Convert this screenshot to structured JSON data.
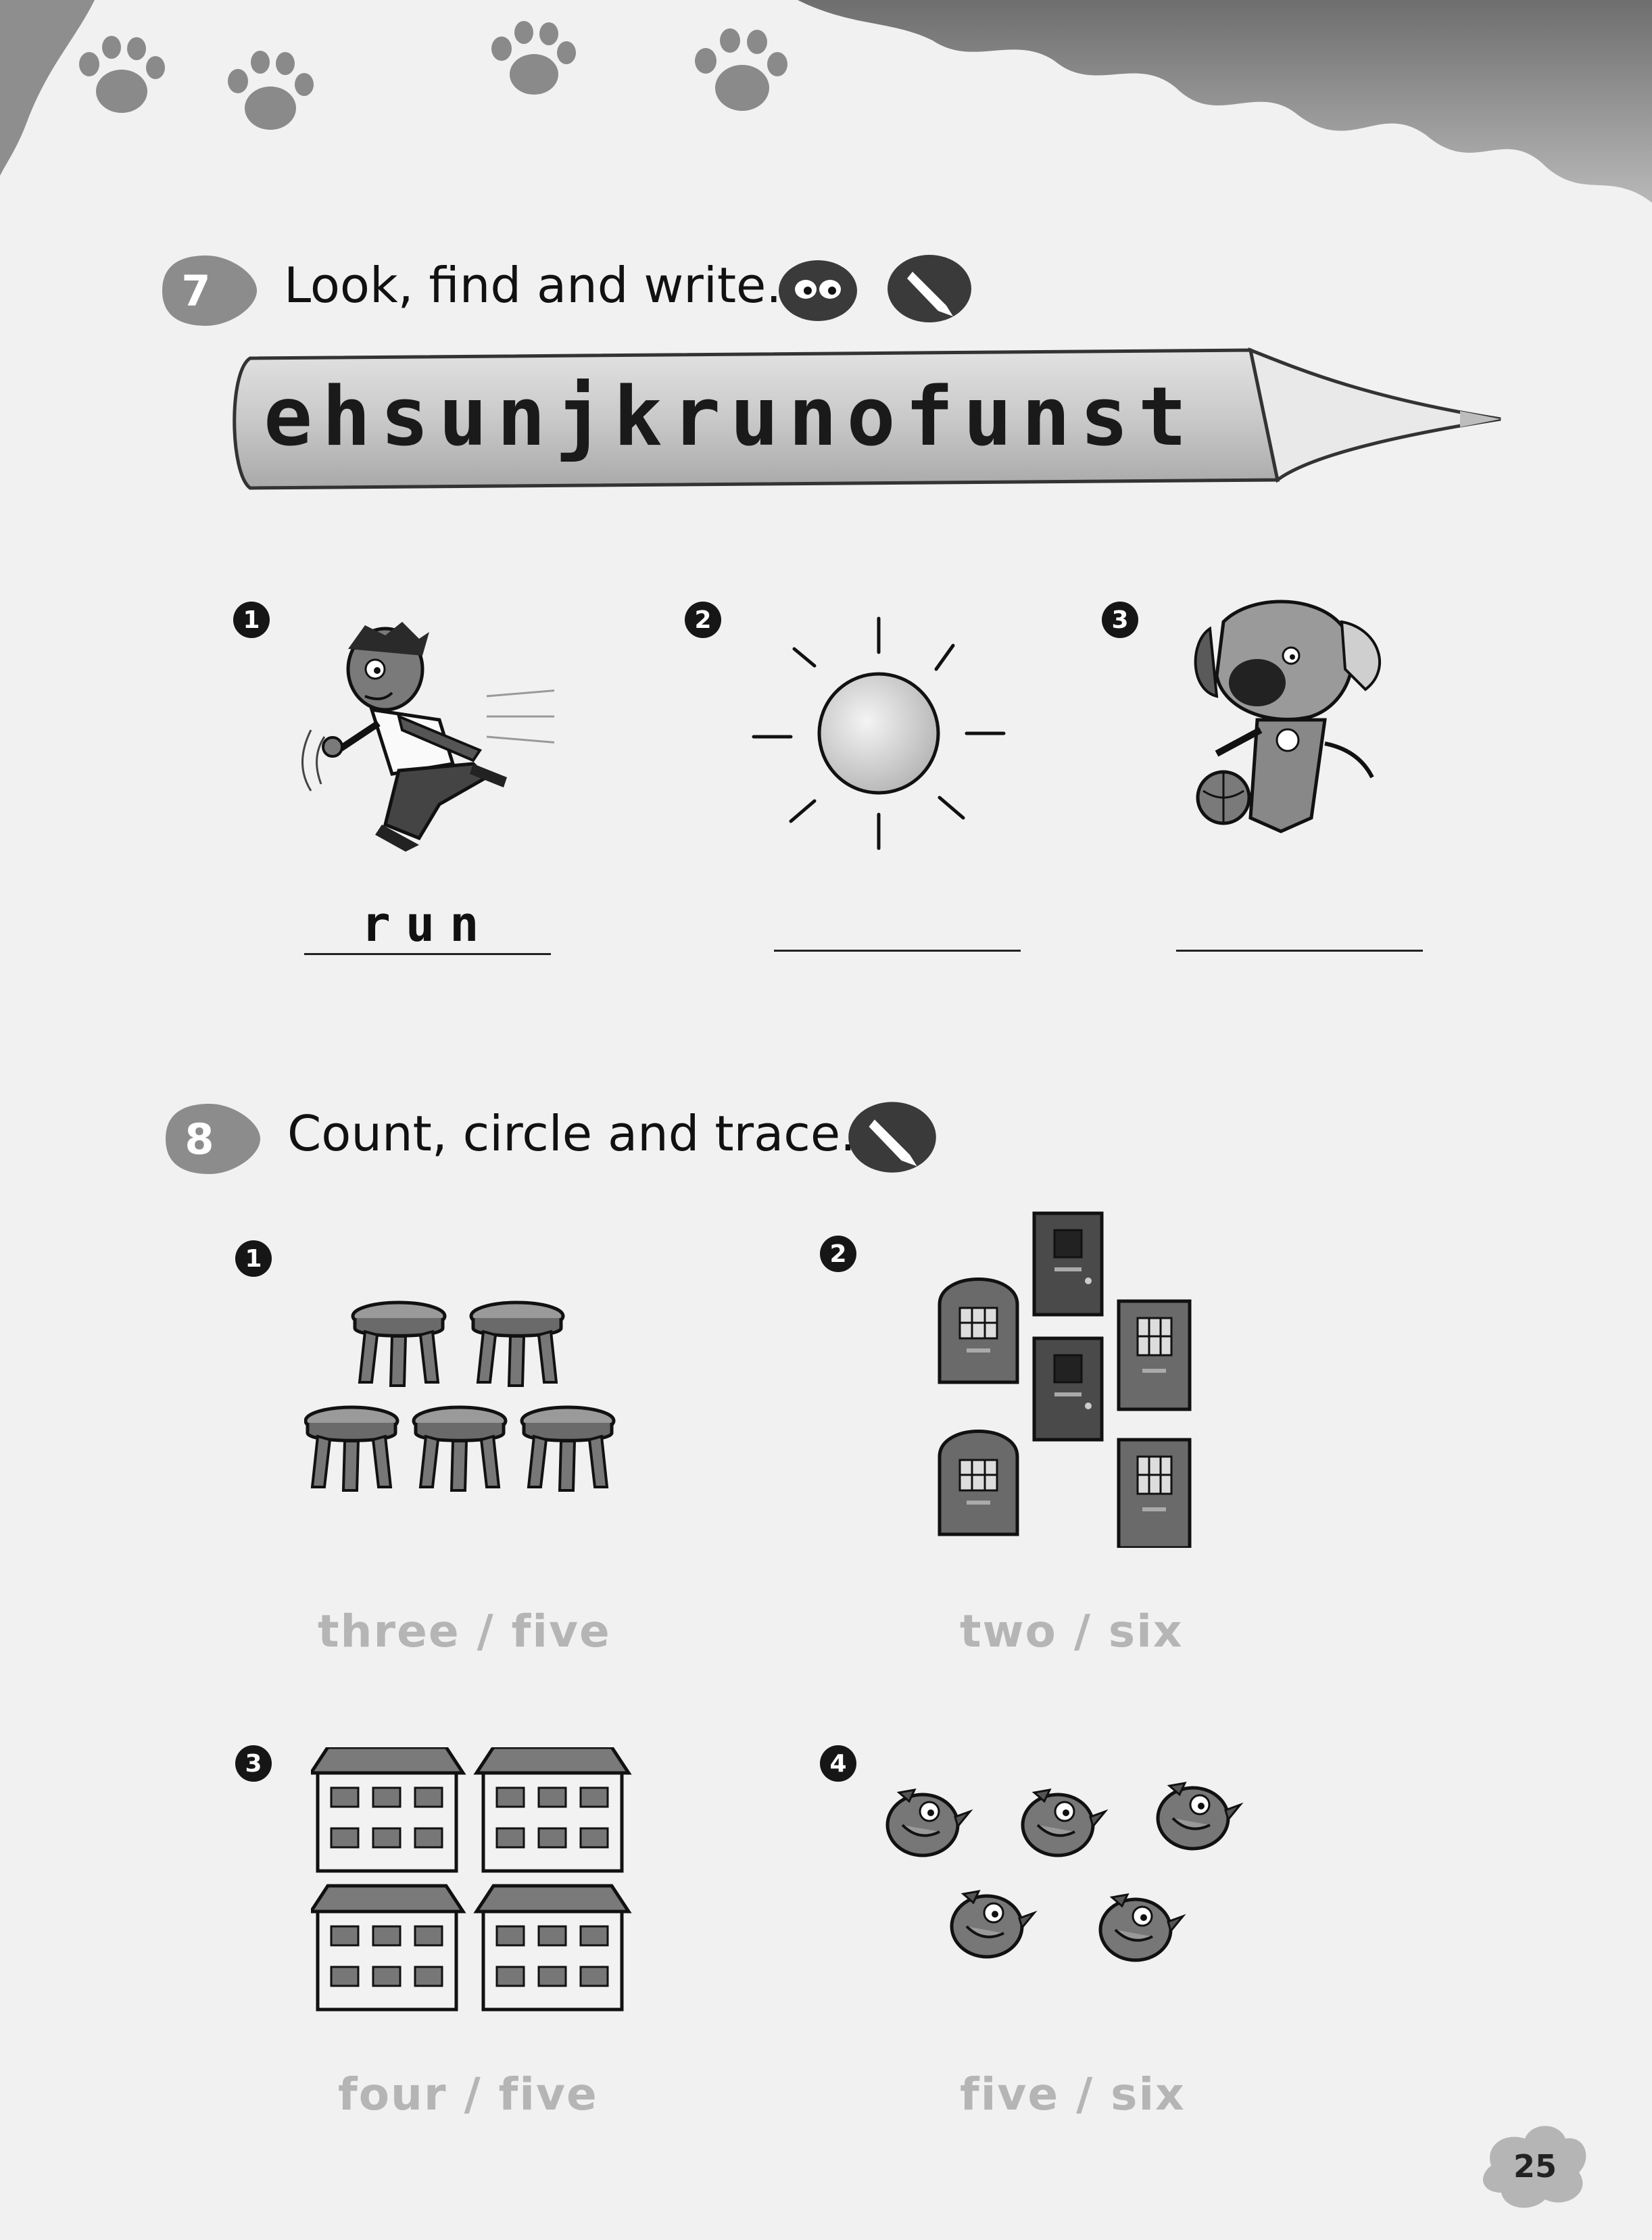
{
  "exercise7": {
    "number": "7",
    "instruction": "Look, find and write.",
    "icons": [
      "eyes-icon",
      "pencil-icon"
    ],
    "letter_string": "ehsunjkrunofunst",
    "items": [
      {
        "marker": "1",
        "picture": "running-boy",
        "answer": "run"
      },
      {
        "marker": "2",
        "picture": "sun",
        "answer": ""
      },
      {
        "marker": "3",
        "picture": "dog-with-ball",
        "answer": ""
      }
    ]
  },
  "exercise8": {
    "number": "8",
    "instruction": "Count, circle and trace.",
    "icons": [
      "pencil-icon"
    ],
    "items": [
      {
        "marker": "1",
        "picture": "stools",
        "count": 5,
        "choice": "three / five"
      },
      {
        "marker": "2",
        "picture": "doors",
        "count": 6,
        "choice": "two / six"
      },
      {
        "marker": "3",
        "picture": "houses",
        "count": 4,
        "choice": "four / five"
      },
      {
        "marker": "4",
        "picture": "birds",
        "count": 5,
        "choice": "five / six"
      }
    ]
  },
  "page_number": "25"
}
